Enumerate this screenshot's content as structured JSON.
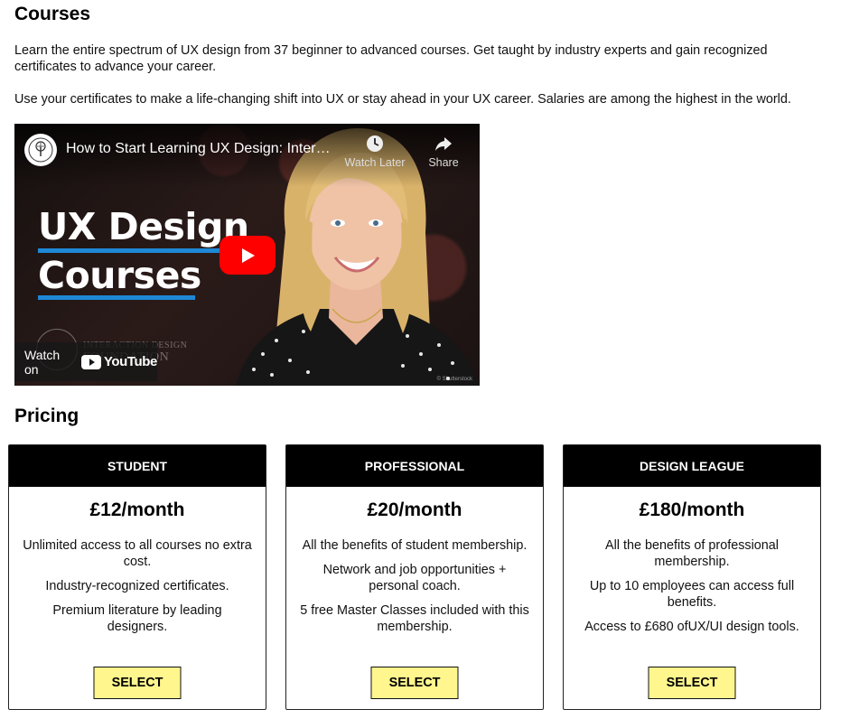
{
  "courses": {
    "heading": "Courses",
    "intro_1": "Learn the entire spectrum of UX design from 37 beginner to advanced courses. Get taught by industry experts and gain recognized certificates to advance your career.",
    "intro_2": "Use your certificates to make a life-changing shift into UX or stay ahead in your UX career. Salaries are among the highest in the world."
  },
  "video": {
    "title": "How to Start Learning UX Design: Inter…",
    "watch_later": "Watch Later",
    "share": "Share",
    "thumb_line1": "UX Design",
    "thumb_line2": "Courses",
    "watermark_line1": "INTERACTION DESIGN",
    "watermark_line2": "FOUNDATION",
    "watch_on": "Watch on",
    "youtube": "YouTube",
    "photo_credit": "© Shutterstock",
    "accent_color": "#1e88d6",
    "play_color": "#ff0000",
    "icons": [
      "ixdf-logo-icon",
      "clock-icon",
      "share-arrow-icon",
      "play-icon",
      "youtube-logo-icon"
    ]
  },
  "pricing": {
    "heading": "Pricing",
    "select_color": "#fff68e",
    "plans": [
      {
        "name": "STUDENT",
        "price": "£12/month",
        "features": [
          "Unlimited access to all courses no extra cost.",
          "Industry-recognized certificates.",
          "Premium literature by leading designers."
        ],
        "button": "SELECT"
      },
      {
        "name": "PROFESSIONAL",
        "price": "£20/month",
        "features": [
          "All the benefits of student membership.",
          "Network and job opportunities + personal coach.",
          "5 free Master Classes included with this membership."
        ],
        "button": "SELECT"
      },
      {
        "name": "DESIGN LEAGUE",
        "price": "£180/month",
        "features": [
          "All the benefits of professional membership.",
          "Up to 10 employees can access full benefits.",
          "Access to £680 ofUX/UI design tools."
        ],
        "button": "SELECT"
      }
    ]
  }
}
